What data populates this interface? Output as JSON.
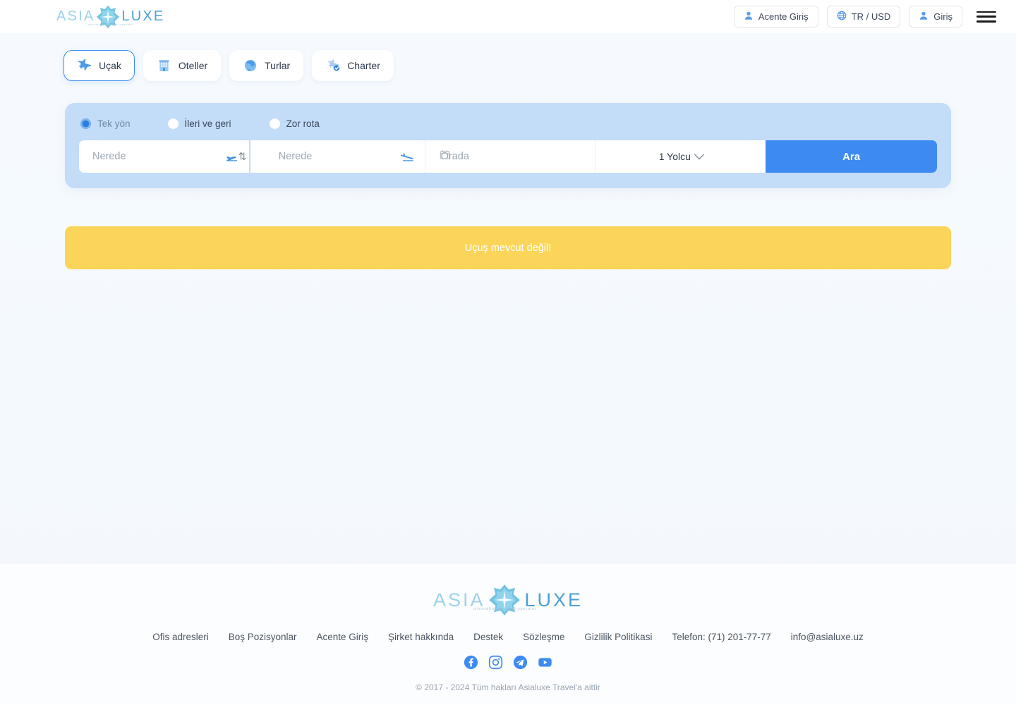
{
  "header": {
    "logo": {
      "left": "ASIA",
      "right": "LUXE",
      "tagline": "international travel operator",
      "mark_icon": "compass-star-icon"
    },
    "buttons": [
      {
        "label": "Acente Giriş",
        "icon": "user-icon"
      },
      {
        "label": "TR / USD",
        "icon": "globe-icon"
      },
      {
        "label": "Giriş",
        "icon": "user-icon"
      }
    ],
    "menu_icon": "hamburger-menu-icon"
  },
  "tabs": [
    {
      "label": "Uçak",
      "icon": "airplane-icon",
      "active": true
    },
    {
      "label": "Oteller",
      "icon": "hotel-building-icon",
      "active": false
    },
    {
      "label": "Turlar",
      "icon": "globe-tour-icon",
      "active": false
    },
    {
      "label": "Charter",
      "icon": "airplane-check-icon",
      "active": false
    }
  ],
  "search": {
    "trip_types": [
      {
        "label": "Tek yön",
        "selected": true
      },
      {
        "label": "İleri ve geri",
        "selected": false
      },
      {
        "label": "Zor rota",
        "selected": false
      }
    ],
    "origin": {
      "placeholder": "Nerede",
      "value": "",
      "icon": "plane-takeoff-icon"
    },
    "destination": {
      "placeholder": "Nerede",
      "value": "",
      "icon": "plane-landing-icon"
    },
    "swap_icon": "swap-vertical-icon",
    "date": {
      "placeholder": "Orada",
      "value": "",
      "icon": "calendar-icon"
    },
    "passengers": {
      "value": "1 Yolcu",
      "icon": "chevron-down-icon"
    },
    "submit_label": "Ara"
  },
  "alert": {
    "message": "Uçuş mevcut değil!",
    "color": "#fad559"
  },
  "footer": {
    "logo": {
      "left": "ASIA",
      "right": "LUXE",
      "tagline": "international travel operator"
    },
    "links": [
      "Ofis adresleri",
      "Boş Pozisyonlar",
      "Acente Giriş",
      "Şirket hakkında",
      "Destek",
      "Sözleşme",
      "Gizlilik Politikasi",
      "Telefon: (71) 201-77-77",
      "info@asialuxe.uz"
    ],
    "socials": [
      {
        "name": "facebook-icon"
      },
      {
        "name": "instagram-icon"
      },
      {
        "name": "telegram-icon"
      },
      {
        "name": "youtube-icon"
      }
    ],
    "copyright": "© 2017 - 2024 Tüm hakları Asialuxe Travel'a aittir"
  },
  "colors": {
    "accent": "#3d8bf2",
    "panel": "#c3dcf8",
    "alert": "#fad559",
    "logo_light": "#9cd2ea",
    "logo_dark": "#4b9fd5"
  }
}
